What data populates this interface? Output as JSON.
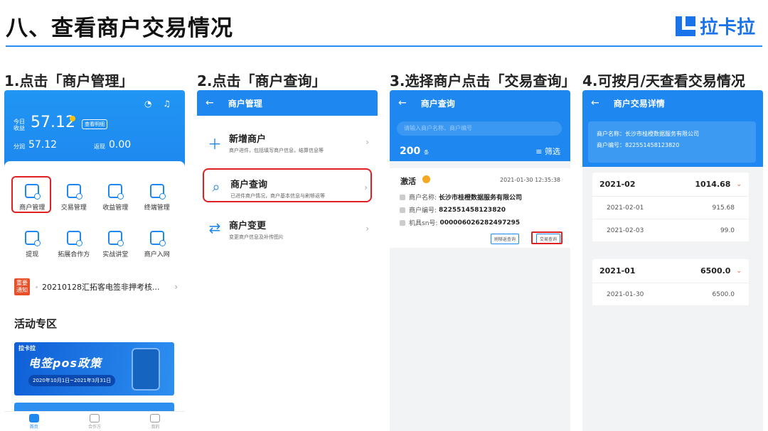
{
  "title": "八、查看商户交易情况",
  "brand": "拉卡拉",
  "steps": [
    "1.点击「商户管理」",
    "2.点击「商户查询」",
    "3.选择商户点击「交易查询」",
    "4.可按月/天查看交易情况"
  ],
  "p1": {
    "today_label": "今日\n收益",
    "today_value": "57.12",
    "detail_btn": "查看明细",
    "split_label": "分润",
    "split_value": "57.12",
    "return_label": "返现",
    "return_value": "0.00",
    "grid": [
      "商户管理",
      "交易管理",
      "收益管理",
      "终端管理",
      "提现",
      "拓展合作方",
      "实战讲堂",
      "商户入网"
    ],
    "notice_tag": "重要通知",
    "notice_text": "20210128汇拓客电签非押考核...",
    "activity_title": "活动专区",
    "banner_logo": "拉卡拉",
    "banner_text": "电签pos政策",
    "banner_date": "2020年10月1日~2021年3月31日",
    "tabs": [
      "首页",
      "合作方",
      "我的"
    ]
  },
  "p2": {
    "bar_title": "商户管理",
    "items": [
      {
        "title": "新增商户",
        "sub": "商户进件，包括填写商户信息，结算信息等"
      },
      {
        "title": "商户查询",
        "sub": "已进件商户情况，商户基本信息与刷够返等"
      },
      {
        "title": "商户变更",
        "sub": "变更商户信息及补传图片"
      }
    ]
  },
  "p3": {
    "bar_title": "商户查询",
    "search_placeholder": "请输入商户名称、商户编号",
    "count": "200",
    "count_unit": "条",
    "filter": "筛选",
    "status": "激活",
    "time": "2021-01-30 12:35:38",
    "name_label": "商户名称:",
    "name_value": "长沙市桂橙数据服务有限公司",
    "no_label": "商户编号:",
    "no_value": "822551458123820",
    "sn_label": "机具sn号:",
    "sn_value": "000006026282497295",
    "btn_refund": "刷够返查询",
    "btn_trade": "交易查询"
  },
  "p4": {
    "bar_title": "商户交易详情",
    "info_name": "商户名称：长沙市桂橙数据服务有限公司",
    "info_no": "商户编号：822551458123820",
    "months": [
      {
        "month": "2021-02",
        "amount": "1014.68",
        "days": [
          {
            "day": "2021-02-01",
            "value": "915.68"
          },
          {
            "day": "2021-02-03",
            "value": "99.0"
          }
        ]
      },
      {
        "month": "2021-01",
        "amount": "6500.0",
        "days": [
          {
            "day": "2021-01-30",
            "value": "6500.0"
          }
        ]
      }
    ]
  }
}
